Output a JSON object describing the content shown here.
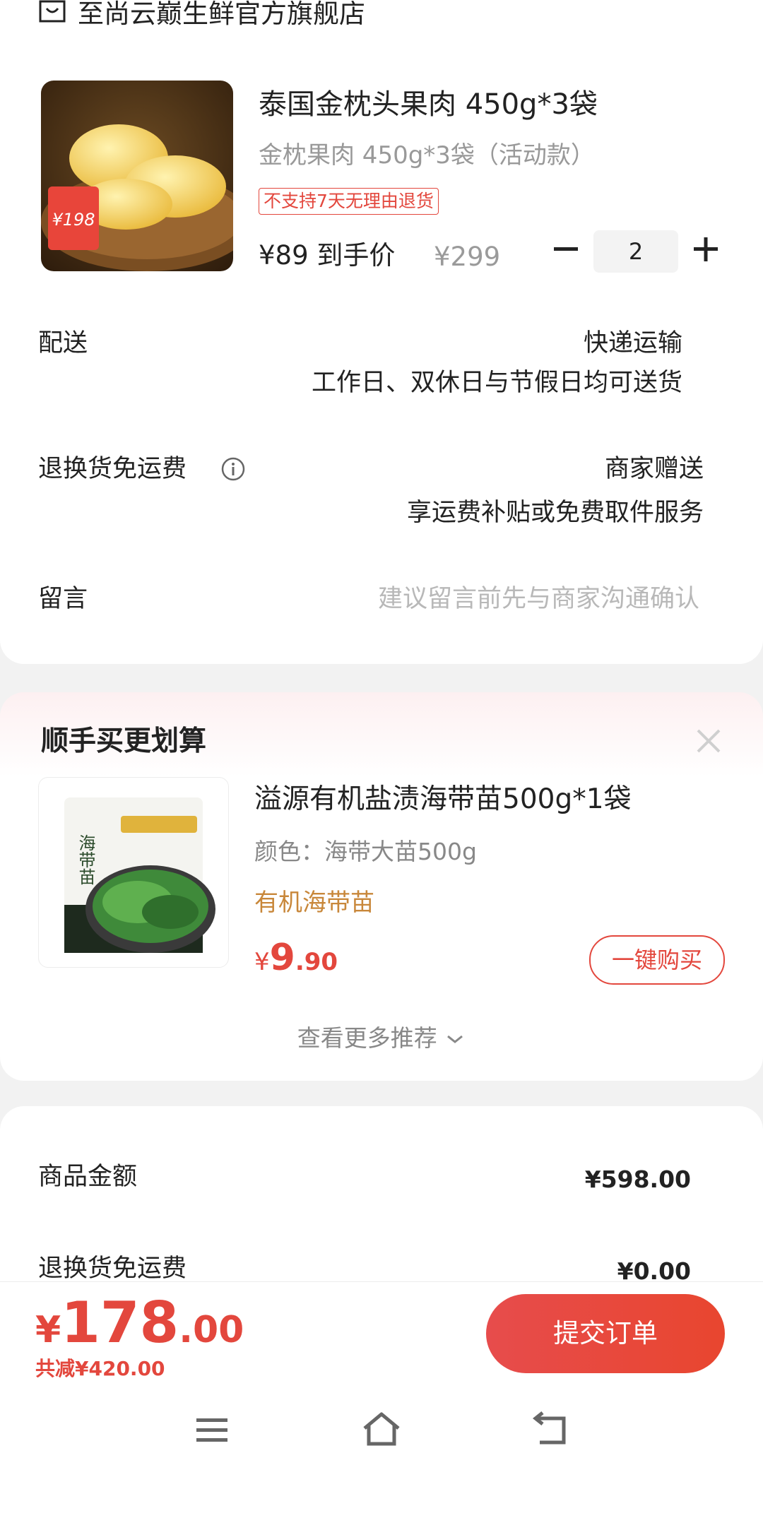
{
  "store": {
    "name": "至尚云巅生鲜官方旗舰店",
    "icon": "store-icon"
  },
  "product": {
    "title": "泰国金枕头果肉 450g*3袋",
    "spec": "金枕果肉 450g*3袋（活动款）",
    "tag": "不支持7天无理由退货",
    "price_text": "¥89 到手价",
    "original_price": "¥299",
    "quantity": "2",
    "image_badge": "¥198"
  },
  "delivery": {
    "label": "配送",
    "method": "快递运输",
    "note": "工作日、双休日与节假日均可送货"
  },
  "return_shipping": {
    "label": "退换货免运费",
    "value": "商家赠送",
    "note": "享运费补贴或免费取件服务"
  },
  "message": {
    "label": "留言",
    "placeholder": "建议留言前先与商家沟通确认"
  },
  "addon": {
    "title": "顺手买更划算",
    "name": "溢源有机盐渍海带苗500g*1袋",
    "spec": "颜色：海带大苗500g",
    "tag": "有机海带苗",
    "price_currency": "¥",
    "price_int": "9",
    "price_dec": ".90",
    "buy_label": "一键购买",
    "more_label": "查看更多推荐",
    "package_text": "海带苗"
  },
  "summary": {
    "items": [
      {
        "label": "商品金额",
        "value": "¥598.00"
      },
      {
        "label": "退换货免运费",
        "value": "¥0.00"
      }
    ]
  },
  "bottom": {
    "currency": "¥",
    "total_int": "178",
    "total_dec": ".00",
    "saved": "共减¥420.00",
    "submit_label": "提交订单"
  },
  "colors": {
    "accent": "#e3473d",
    "tag_orange": "#c8873a"
  }
}
